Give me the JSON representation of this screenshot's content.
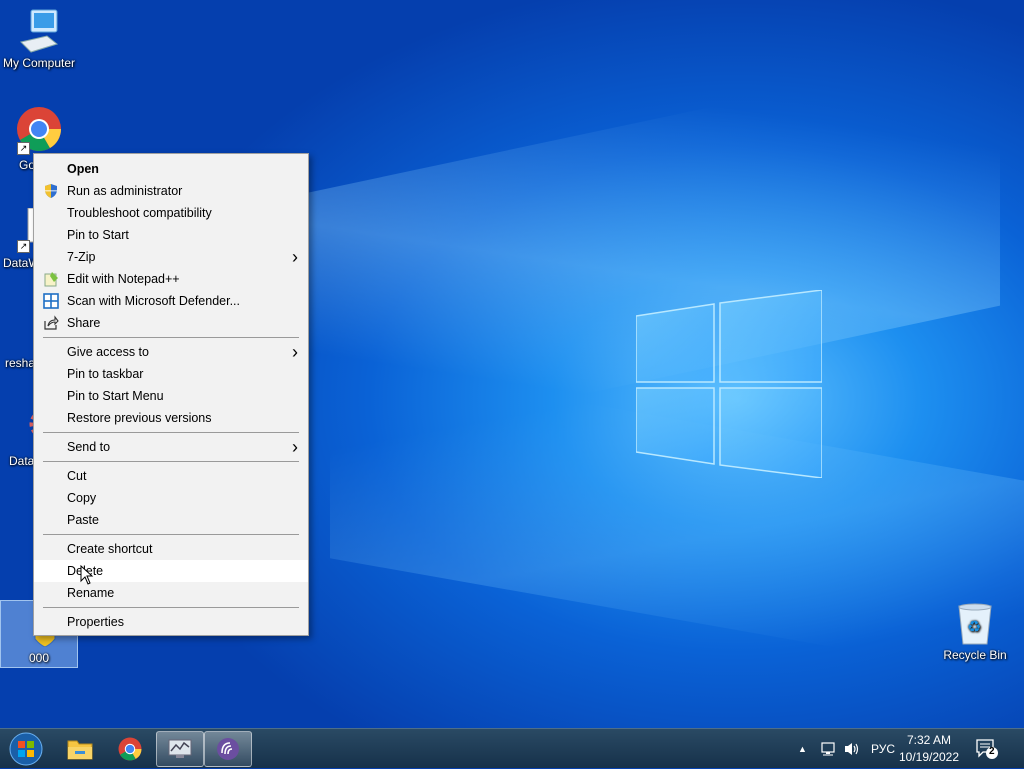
{
  "desktop": {
    "icons": [
      {
        "label": "My Computer"
      },
      {
        "label": "Go\nCh"
      },
      {
        "label": "DataW"
      },
      {
        "label": "resha"
      },
      {
        "label": "Data"
      },
      {
        "label": "000"
      },
      {
        "label": "Recycle Bin"
      }
    ]
  },
  "context_menu": {
    "items": [
      {
        "label": "Open"
      },
      {
        "label": "Run as administrator",
        "icon": "shield-icon"
      },
      {
        "label": "Troubleshoot compatibility"
      },
      {
        "label": "Pin to Start"
      },
      {
        "label": "7-Zip",
        "submenu": true
      },
      {
        "label": "Edit with Notepad++",
        "icon": "notepadpp-icon"
      },
      {
        "label": "Scan with Microsoft Defender...",
        "icon": "defender-icon"
      },
      {
        "label": "Share",
        "icon": "share-icon"
      },
      {
        "label": "Give access to",
        "submenu": true
      },
      {
        "label": "Pin to taskbar"
      },
      {
        "label": "Pin to Start Menu"
      },
      {
        "label": "Restore previous versions"
      },
      {
        "label": "Send to",
        "submenu": true
      },
      {
        "label": "Cut"
      },
      {
        "label": "Copy"
      },
      {
        "label": "Paste"
      },
      {
        "label": "Create shortcut"
      },
      {
        "label": "Delete"
      },
      {
        "label": "Rename"
      },
      {
        "label": "Properties"
      }
    ],
    "submenu_glyph": "›"
  },
  "taskbar": {
    "language": "РУС",
    "time": "7:32 AM",
    "date": "10/19/2022",
    "notification_count": "2",
    "tray_chevron": "▲"
  },
  "colors": {
    "accent": "#0a62d6",
    "menu_bg": "#f2f2f2",
    "taskbar": "#1e3a56"
  }
}
